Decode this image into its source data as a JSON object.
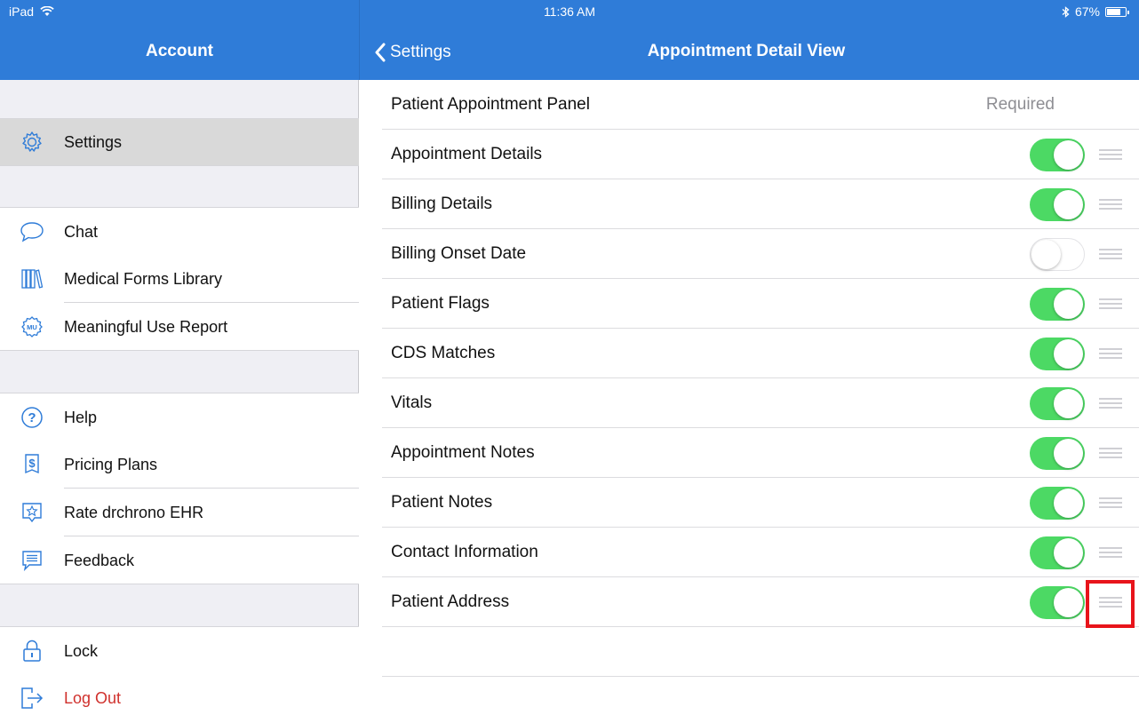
{
  "status": {
    "carrier": "iPad",
    "time": "11:36 AM",
    "battery": "67%"
  },
  "sidebar": {
    "title": "Account",
    "items": [
      {
        "label": "Settings",
        "icon": "gear-icon"
      },
      {
        "label": "Chat",
        "icon": "chat-bubble-icon"
      },
      {
        "label": "Medical Forms Library",
        "icon": "library-icon"
      },
      {
        "label": "Meaningful Use Report",
        "icon": "mu-badge-icon"
      },
      {
        "label": "Help",
        "icon": "question-icon"
      },
      {
        "label": "Pricing Plans",
        "icon": "dollar-icon"
      },
      {
        "label": "Rate drchrono EHR",
        "icon": "star-icon"
      },
      {
        "label": "Feedback",
        "icon": "feedback-icon"
      },
      {
        "label": "Lock",
        "icon": "lock-icon"
      },
      {
        "label": "Log Out",
        "icon": "logout-icon"
      }
    ]
  },
  "nav": {
    "back_label": "Settings",
    "title": "Appointment Detail View"
  },
  "rows": [
    {
      "label": "Patient Appointment Panel",
      "status": "Required"
    },
    {
      "label": "Appointment Details",
      "enabled": true
    },
    {
      "label": "Billing Details",
      "enabled": true
    },
    {
      "label": "Billing Onset Date",
      "enabled": false
    },
    {
      "label": "Patient Flags",
      "enabled": true
    },
    {
      "label": "CDS Matches",
      "enabled": true
    },
    {
      "label": "Vitals",
      "enabled": true
    },
    {
      "label": "Appointment Notes",
      "enabled": true
    },
    {
      "label": "Patient Notes",
      "enabled": true
    },
    {
      "label": "Contact Information",
      "enabled": true
    },
    {
      "label": "Patient Address",
      "enabled": true
    }
  ],
  "colors": {
    "accent": "#2f7cd8",
    "toggle_on": "#4cd964",
    "logout": "#d0312d",
    "highlight": "#e8141b"
  }
}
